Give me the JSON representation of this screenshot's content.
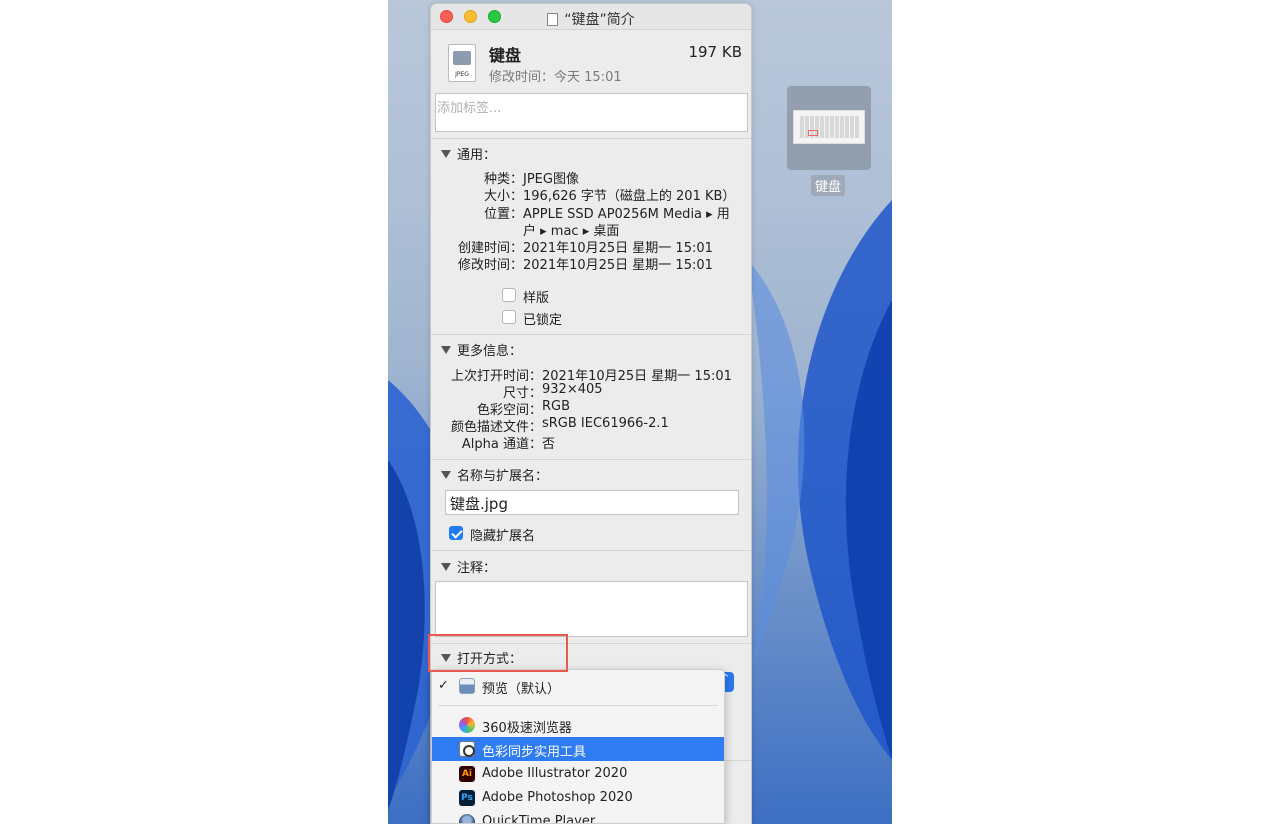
{
  "window": {
    "title": "“键盘”简介"
  },
  "header": {
    "file_name": "键盘",
    "file_size": "197 KB",
    "modified_label": "修改时间：",
    "modified_value": "今天 15:01",
    "icon_tag": "JPEG"
  },
  "tags_input": {
    "placeholder": "添加标签..."
  },
  "general": {
    "title": "通用：",
    "rows": [
      {
        "key": "种类：",
        "value": "JPEG图像"
      },
      {
        "key": "大小：",
        "value": "196,626 字节（磁盘上的 201 KB）"
      },
      {
        "key": "位置：",
        "value": "APPLE SSD AP0256M Media ▸ 用"
      },
      {
        "key": "",
        "value": "户 ▸ mac ▸ 桌面"
      },
      {
        "key": "创建时间：",
        "value": "2021年10月25日 星期一 15:01"
      },
      {
        "key": "修改时间：",
        "value": "2021年10月25日 星期一 15:01"
      }
    ],
    "stationery_label": "样版",
    "locked_label": "已锁定"
  },
  "more_info": {
    "title": "更多信息：",
    "rows": [
      {
        "key": "上次打开时间：",
        "value": "2021年10月25日 星期一 15:01"
      },
      {
        "key": "尺寸：",
        "value": "932×405"
      },
      {
        "key": "色彩空间：",
        "value": "RGB"
      },
      {
        "key": "颜色描述文件：",
        "value": "sRGB IEC61966-2.1"
      },
      {
        "key": "Alpha 通道：",
        "value": "否"
      }
    ]
  },
  "name_ext": {
    "title": "名称与扩展名：",
    "filename_value": "键盘.jpg",
    "hide_ext_label": "隐藏扩展名"
  },
  "comments": {
    "title": "注释："
  },
  "open_with": {
    "title": "打开方式：",
    "menu": [
      {
        "label": "预览（默认）",
        "icon": "preview-icon",
        "checked": true
      },
      {
        "label": "360极速浏览器",
        "icon": "browser-360-icon"
      },
      {
        "label": "色彩同步实用工具",
        "icon": "colorsync-icon",
        "selected": true
      },
      {
        "label": "Adobe Illustrator 2020",
        "icon": "illustrator-icon",
        "badge": "Ai"
      },
      {
        "label": "Adobe Photoshop 2020",
        "icon": "photoshop-icon",
        "badge": "Ps"
      },
      {
        "label": "QuickTime Player",
        "icon": "quicktime-icon"
      }
    ]
  },
  "desktop": {
    "file_label": "键盘"
  },
  "colors": {
    "accent": "#2f7bf2",
    "highlight": "#e65a52",
    "window_bg": "#ececec"
  }
}
